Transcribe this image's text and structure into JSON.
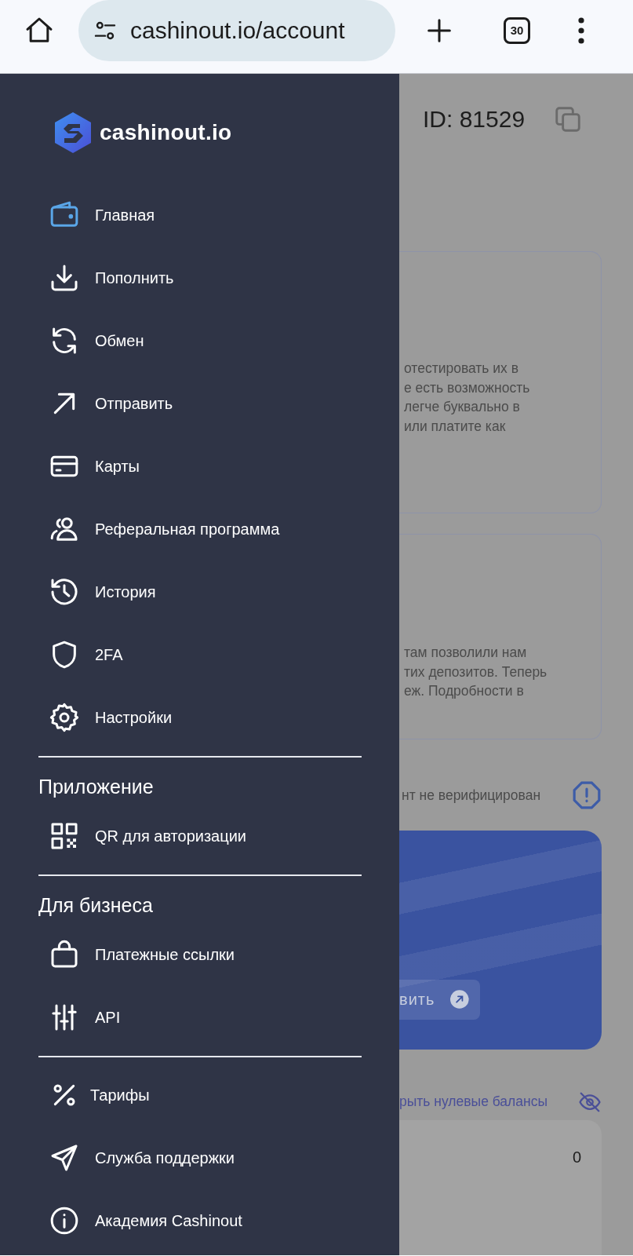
{
  "browser": {
    "url": "cashinout.io/account",
    "tab_count": "30"
  },
  "sidebar": {
    "logo_text": "cashinout.io",
    "sections": [
      {
        "items": [
          {
            "label": "Главная",
            "selected": true
          },
          {
            "label": "Пополнить",
            "selected": false
          },
          {
            "label": "Обмен",
            "selected": false
          },
          {
            "label": "Отправить",
            "selected": false
          },
          {
            "label": "Карты",
            "selected": false
          },
          {
            "label": "Реферальная программа",
            "selected": false
          },
          {
            "label": "История",
            "selected": false
          },
          {
            "label": "2FA",
            "selected": false
          },
          {
            "label": "Настройки",
            "selected": false
          }
        ]
      },
      {
        "heading": "Приложение",
        "items": [
          {
            "label": "QR для авторизации",
            "selected": false
          }
        ]
      },
      {
        "heading": "Для бизнеса",
        "items": [
          {
            "label": "Платежные ссылки",
            "selected": false
          },
          {
            "label": "API",
            "selected": false
          }
        ]
      },
      {
        "items": [
          {
            "label": "Тарифы",
            "selected": false
          },
          {
            "label": "Служба поддержки",
            "selected": false
          },
          {
            "label": "Академия Cashinout",
            "selected": false
          }
        ]
      }
    ]
  },
  "page": {
    "account_id": "ID: 81529",
    "info_cards": [
      {
        "lines": [
          "отестировать их в",
          "е есть возможность",
          "легче буквально в",
          "или платите как"
        ]
      },
      {
        "lines": [
          "там позволили нам",
          "тих депозитов. Теперь",
          "еж. Подробности в"
        ]
      }
    ],
    "verification_status": "нт не верифицирован",
    "balance_card": {
      "button": "вить"
    },
    "hide_zero_link": "рыть нулевые балансы",
    "balance_row": {
      "amount": "0"
    }
  }
}
